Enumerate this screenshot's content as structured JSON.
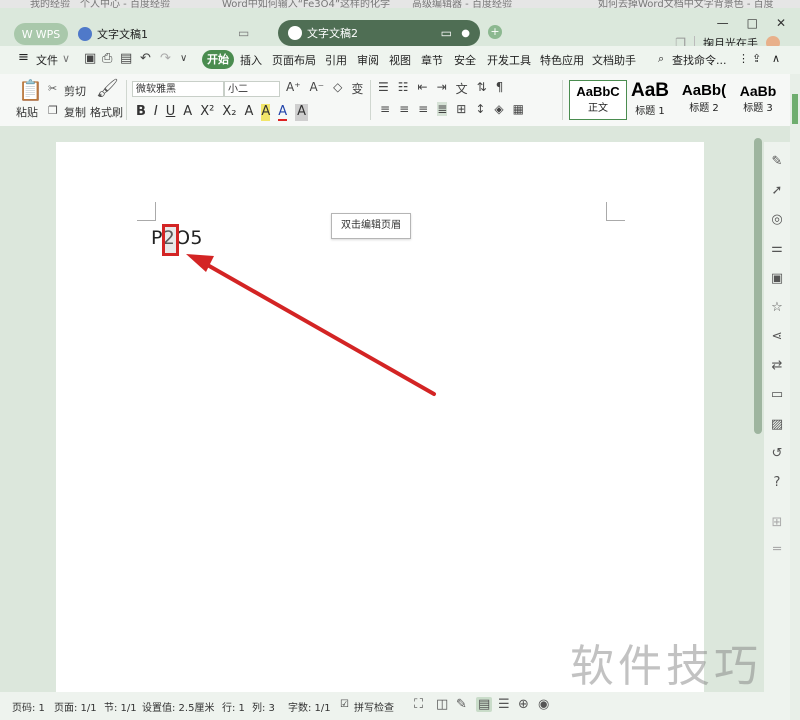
{
  "browser_strip": [
    "我的经验",
    "个人中心 - 百度经验",
    "Word中如何输入“Fe3O4”这样的化学",
    "高级编辑器 - 百度经验",
    "如何去掉Word文档中文字背景色 - 百度"
  ],
  "app": {
    "logo": "WPS",
    "tabs": [
      {
        "label": "文字文稿1",
        "active": false
      },
      {
        "label": "文字文稿2",
        "active": true
      }
    ],
    "new_tab": "+",
    "window_controls": [
      "—",
      "□",
      "✕"
    ],
    "user_name": "掬月光在手"
  },
  "menu": {
    "file": "文件",
    "items": [
      "开始",
      "插入",
      "页面布局",
      "引用",
      "审阅",
      "视图",
      "章节",
      "安全",
      "开发工具",
      "特色应用",
      "文档助手"
    ],
    "search": "查找命令..."
  },
  "toolbar": {
    "paste": "粘贴",
    "cut": "剪切",
    "copy": "复制",
    "format_painter": "格式刷",
    "font_name": "微软雅黑",
    "font_size": "小二",
    "format_buttons": [
      "B",
      "I",
      "U",
      "A",
      "X²",
      "X₂",
      "A",
      "A",
      "A"
    ],
    "styles": [
      {
        "preview": "AaBbC",
        "label": "正文"
      },
      {
        "preview": "AaB",
        "label": "标题 1"
      },
      {
        "preview": "AaBb(",
        "label": "标题 2"
      },
      {
        "preview": "AaBb",
        "label": "标题 3"
      }
    ]
  },
  "document": {
    "header_button": "双击编辑页眉",
    "text": "P2O5",
    "highlight_color": "#d32424"
  },
  "status": {
    "page": "页码: 1",
    "pages": "页面: 1/1",
    "section": "节: 1/1",
    "setting": "设置值: 2.5厘米",
    "row": "行: 1",
    "col": "列: 3",
    "words": "字数: 1/1",
    "spellcheck": "拼写检查"
  },
  "watermark": "软件技巧",
  "colors": {
    "accent": "#4a8c4f",
    "annotation": "#d32424"
  }
}
